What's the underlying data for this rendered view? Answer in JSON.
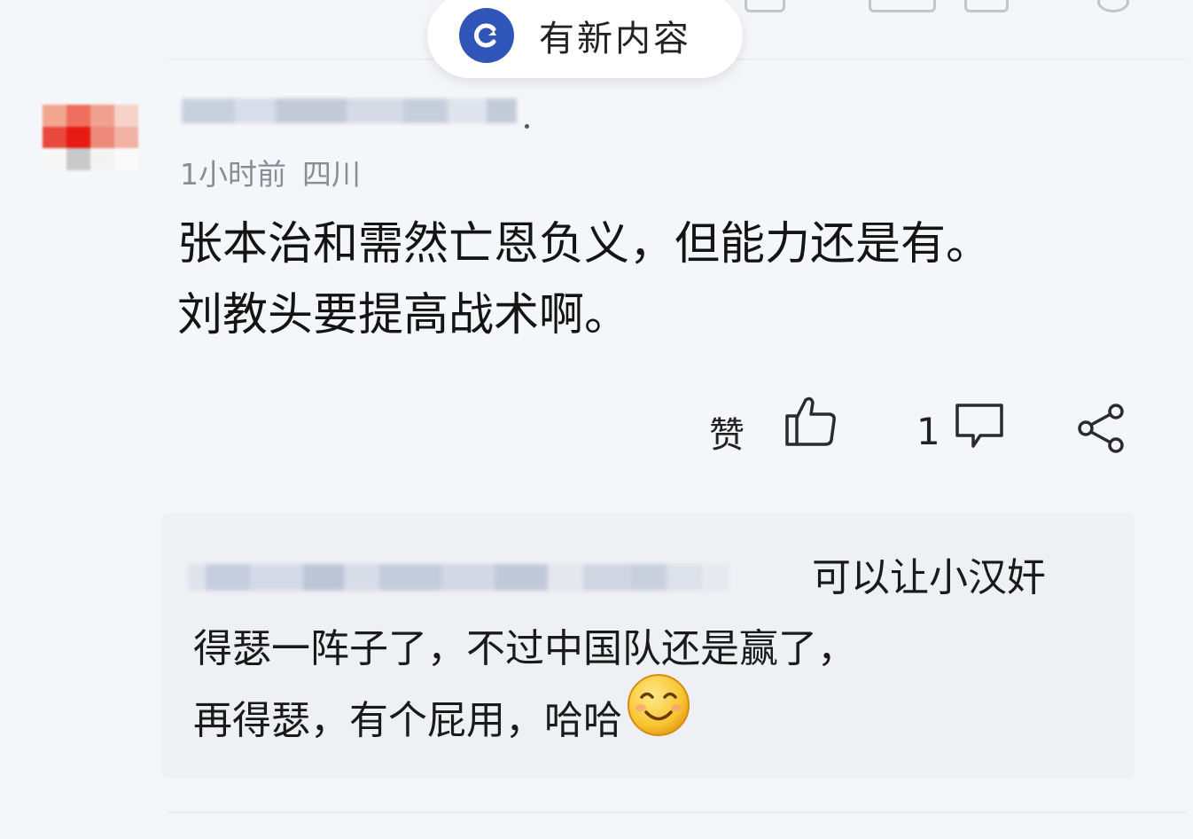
{
  "notice": {
    "new_content_label": "有新内容",
    "icon": "refresh-icon",
    "accent": "#2f55b8"
  },
  "comment": {
    "time": "1小时前",
    "location": "四川",
    "line1": "张本治和需然亡恩负义，但能力还是有。",
    "line2": "刘教头要提高战术啊。"
  },
  "actions": {
    "like_label": "赞",
    "like_icon": "thumbs-up-icon",
    "reply_count": "1",
    "reply_icon": "comment-bubble-icon",
    "share_icon": "share-icon"
  },
  "reply": {
    "line1": "可以让小汉奸",
    "line2": "得瑟一阵子了，不过中国队还是赢了，",
    "line3": "再得瑟，有个屁用，哈哈",
    "emoji": "smile-emoji-icon"
  }
}
